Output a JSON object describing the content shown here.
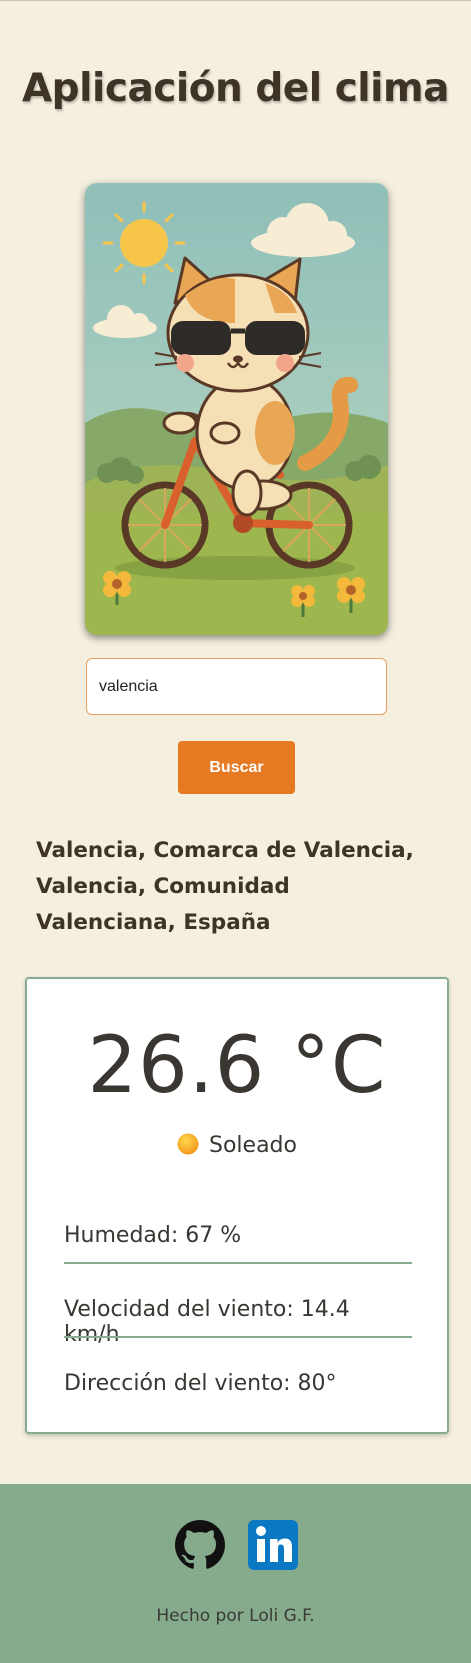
{
  "header": {
    "title": "Aplicación del clima"
  },
  "search": {
    "value": "valencia",
    "button_label": "Buscar"
  },
  "location": {
    "name": "Valencia, Comarca de Valencia, Valencia, Comunidad Valenciana, España"
  },
  "weather": {
    "temperature": "26.6 °C",
    "condition": "Soleado",
    "condition_icon": "sun-icon",
    "humidity": "Humedad: 67 %",
    "wind_speed": "Velocidad del viento: 14.4 km/h",
    "wind_direction": "Dirección del viento: 80°"
  },
  "footer": {
    "credit": "Hecho por Loli G.F.",
    "icons": [
      "github-icon",
      "linkedin-icon"
    ]
  },
  "colors": {
    "background": "#f4efdf",
    "accent": "#e67a22",
    "card_border": "#86ad8f",
    "footer": "#86aa8c"
  }
}
